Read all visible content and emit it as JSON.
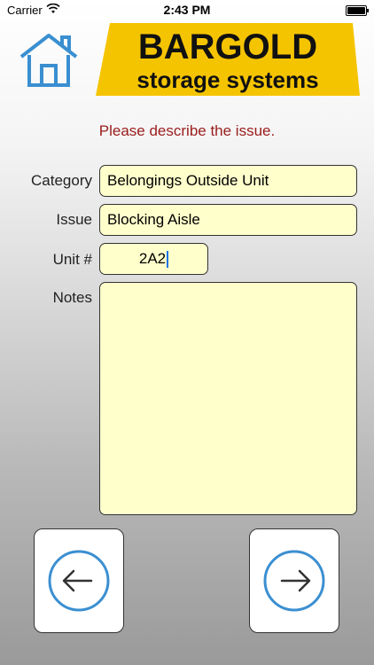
{
  "status_bar": {
    "carrier": "Carrier",
    "time": "2:43 PM",
    "battery_level": 1.0
  },
  "header": {
    "home_icon": "home-icon",
    "logo": {
      "line1": "BARGOLD",
      "line2": "storage systems",
      "bg_color": "#f5c400",
      "text_color": "#111111"
    }
  },
  "prompt": "Please describe the issue.",
  "form": {
    "category": {
      "label": "Category",
      "value": "Belongings Outside Unit"
    },
    "issue": {
      "label": "Issue",
      "value": "Blocking Aisle"
    },
    "unit": {
      "label": "Unit #",
      "value": "2A2"
    },
    "notes": {
      "label": "Notes",
      "value": ""
    }
  },
  "nav": {
    "back_icon": "arrow-left-icon",
    "next_icon": "arrow-right-icon",
    "icon_color": "#3b8fd1"
  }
}
